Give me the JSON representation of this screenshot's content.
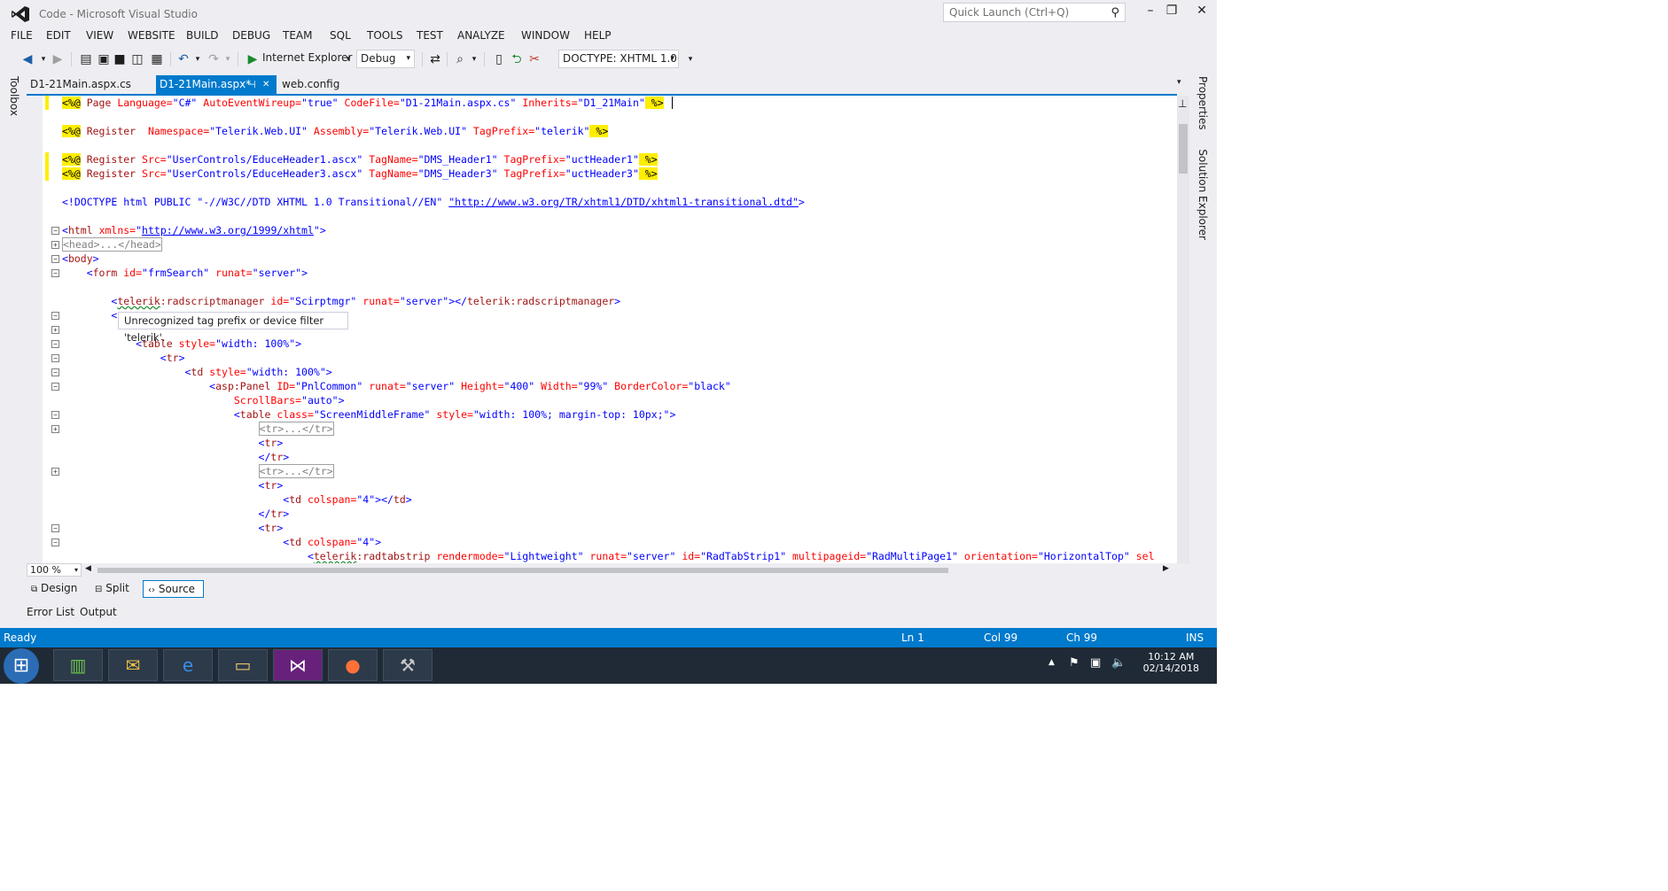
{
  "window": {
    "title": "Code - Microsoft Visual Studio",
    "quick_launch_placeholder": "Quick Launch (Ctrl+Q)",
    "minimize": "–",
    "maximize": "❐",
    "close": "✕"
  },
  "menu": [
    "FILE",
    "EDIT",
    "VIEW",
    "WEBSITE",
    "BUILD",
    "DEBUG",
    "TEAM",
    "SQL",
    "TOOLS",
    "TEST",
    "ANALYZE",
    "WINDOW",
    "HELP"
  ],
  "toolbar": {
    "run_target": "Internet Explorer",
    "config": "Debug",
    "doctype": "DOCTYPE: XHTML 1.0"
  },
  "tabs": {
    "tab1": "D1-21Main.aspx.cs",
    "tab2": "D1-21Main.aspx*",
    "tab2_pin": "⊣",
    "tab2_close": "✕",
    "tab3": "web.config"
  },
  "side": {
    "toolbox": "Toolbox",
    "properties": "Properties",
    "solution_explorer": "Solution Explorer"
  },
  "code": {
    "l1": [
      "<%@",
      " Page",
      " Language=",
      "\"C#\"",
      " AutoEventWireup=",
      "\"true\"",
      " CodeFile=",
      "\"D1-21Main.aspx.cs\"",
      " Inherits=",
      "\"D1_21Main\"",
      " %>"
    ],
    "l2": [
      "<%@",
      " Register",
      "  Namespace=",
      "\"Telerik.Web.UI\"",
      " Assembly=",
      "\"Telerik.Web.UI\"",
      " TagPrefix=",
      "\"telerik\"",
      " %>"
    ],
    "l3": [
      "<%@",
      " Register",
      " Src=",
      "\"UserControls/EduceHeader1.ascx\"",
      " TagName=",
      "\"DMS_Header1\"",
      " TagPrefix=",
      "\"uctHeader1\"",
      " %>"
    ],
    "l4": [
      "<%@",
      " Register",
      " Src=",
      "\"UserControls/EduceHeader3.ascx\"",
      " TagName=",
      "\"DMS_Header3\"",
      " TagPrefix=",
      "\"uctHeader3\"",
      " %>"
    ],
    "l5": [
      "<!DOCTYPE html PUBLIC ",
      "\"-//W3C//DTD XHTML 1.0 Transitional//EN\"",
      " ",
      "\"http://www.w3.org/TR/xhtml1/DTD/xhtml1-transitional.dtd\"",
      ">"
    ],
    "l6": [
      "<",
      "html",
      " xmlns=",
      "\"",
      "http://www.w3.org/1999/xhtml",
      "\"",
      ">"
    ],
    "l7": "<head>...</head>",
    "l8": [
      "<",
      "body",
      ">"
    ],
    "l9": [
      "    <",
      "form",
      " id=",
      "\"frmSearch\"",
      " runat=",
      "\"server\"",
      ">"
    ],
    "l10": [
      "        <",
      "telerik",
      ":radscriptmanager",
      " id=",
      "\"Scirptmgr\"",
      " runat=",
      "\"server\"",
      "></",
      "telerik:radscriptmanager",
      ">"
    ],
    "l11": "        <",
    "l12": [
      "            <",
      "table",
      " style=",
      "\"width: 100%\"",
      ">"
    ],
    "l13": [
      "                <",
      "tr",
      ">"
    ],
    "l14": [
      "                    <",
      "td",
      " style=",
      "\"width: 100%\"",
      ">"
    ],
    "l15": [
      "                        <",
      "asp:Panel",
      " ID=",
      "\"PnlCommon\"",
      " runat=",
      "\"server\"",
      " Height=",
      "\"400\"",
      " Width=",
      "\"99%\"",
      " BorderColor=",
      "\"black\""
    ],
    "l16": [
      "                            ",
      "ScrollBars=",
      "\"auto\"",
      ">"
    ],
    "l17": [
      "                            <",
      "table",
      " class=",
      "\"ScreenMiddleFrame\"",
      " style=",
      "\"width: 100%; margin-top: 10px;\"",
      ">"
    ],
    "l18": "<tr>...</tr>",
    "l19": [
      "                                <",
      "tr",
      ">"
    ],
    "l20": [
      "                                </",
      "tr",
      ">"
    ],
    "l21": "<tr>...</tr>",
    "l22": [
      "                                <",
      "tr",
      ">"
    ],
    "l23": [
      "                                    <",
      "td",
      " colspan=",
      "\"4\"",
      "></",
      "td",
      ">"
    ],
    "l24": [
      "                                </",
      "tr",
      ">"
    ],
    "l25": [
      "                                <",
      "tr",
      ">"
    ],
    "l26": [
      "                                    <",
      "td",
      " colspan=",
      "\"4\"",
      ">"
    ],
    "l27": [
      "                                        <",
      "telerik",
      ":radtabstrip",
      " rendermode=",
      "\"Lightweight\"",
      " runat=",
      "\"server\"",
      " id=",
      "\"RadTabStrip1\"",
      " multipageid=",
      "\"RadMultiPage1\"",
      " orientation=",
      "\"HorizontalTop\"",
      " sel"
    ]
  },
  "tooltip": "Unrecognized tag prefix or device filter 'telerik'.",
  "zoom": "100 %",
  "view_tabs": {
    "design": "Design",
    "split": "Split",
    "source": "Source"
  },
  "bottom_tabs": {
    "error_list": "Error List",
    "output": "Output"
  },
  "status": {
    "ready": "Ready",
    "ln": "Ln 1",
    "col": "Col 99",
    "ch": "Ch 99",
    "ins": "INS"
  },
  "taskbar": {
    "time": "10:12 AM",
    "date": "02/14/2018"
  },
  "colors": {
    "accent": "#007acc",
    "chrome": "#eeeef2",
    "keyword": "#0000ff",
    "element": "#a31515",
    "attribute": "#ff0000",
    "directive_highlight": "#ffee00"
  }
}
